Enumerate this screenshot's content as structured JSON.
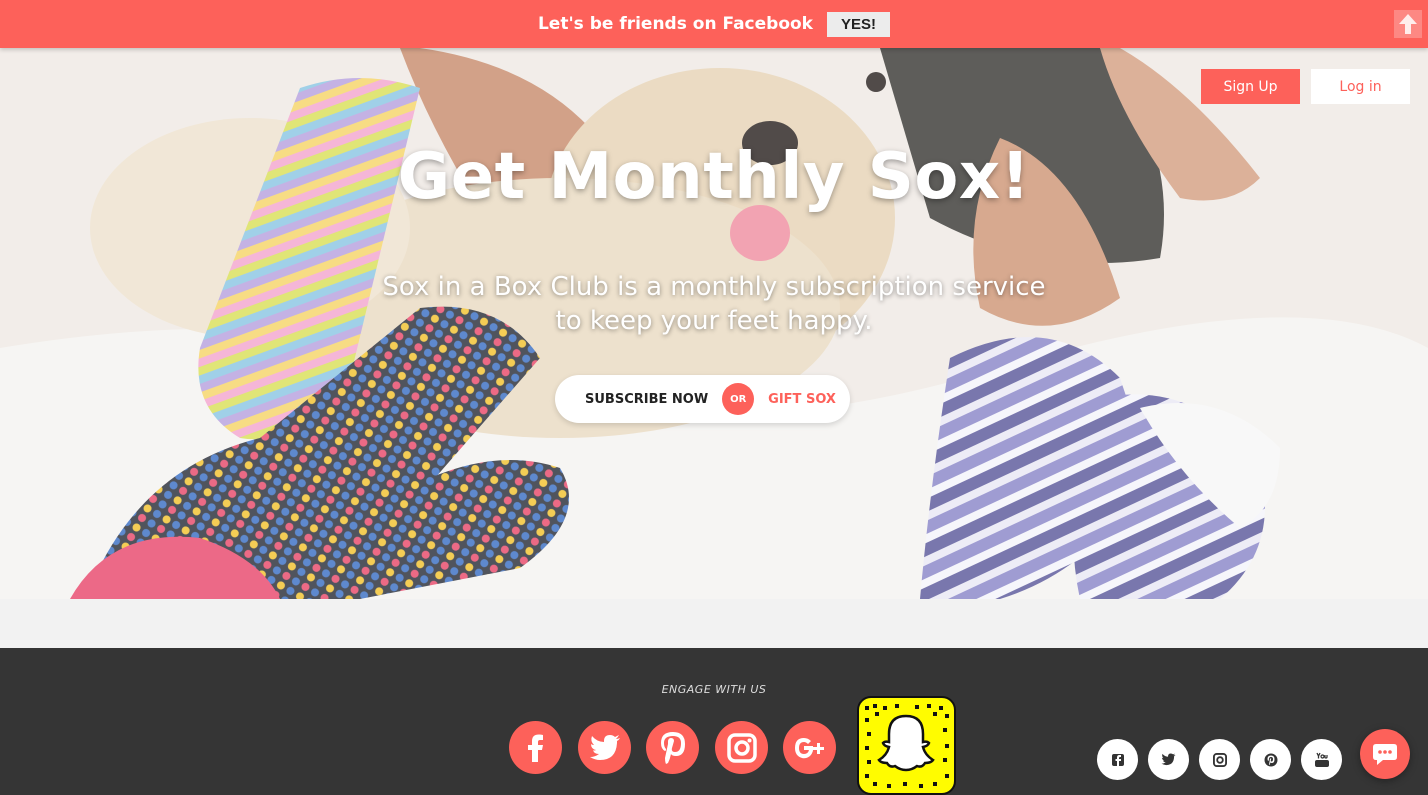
{
  "banner": {
    "message": "Let's be friends on Facebook",
    "yes_label": "YES!",
    "scroll_icon": "arrow-up-icon"
  },
  "auth": {
    "signup_label": "Sign Up",
    "login_label": "Log in"
  },
  "hero": {
    "title": "Get Monthly Sox!",
    "tagline_line1": "Sox in a Box Club is a monthly subscription service",
    "tagline_line2": "to keep your feet happy.",
    "subscribe_label": "SUBSCRIBE NOW",
    "or_label": "OR",
    "gift_label": "GIFT SOX"
  },
  "footer": {
    "engage_label": "ENGAGE WITH US",
    "social_icons": [
      "facebook-icon",
      "twitter-icon",
      "pinterest-icon",
      "instagram-icon",
      "google-plus-icon"
    ],
    "snapcode_icon": "snapchat-ghost-icon",
    "mini_icons": [
      "facebook-icon",
      "twitter-icon",
      "instagram-icon",
      "pinterest-icon",
      "youtube-icon"
    ],
    "chat_icon": "chat-bubble-icon"
  },
  "colors": {
    "accent": "#fd615a",
    "footer_bg": "#353535",
    "band_bg": "#f2f2f2",
    "snap_yellow": "#fffc00"
  }
}
